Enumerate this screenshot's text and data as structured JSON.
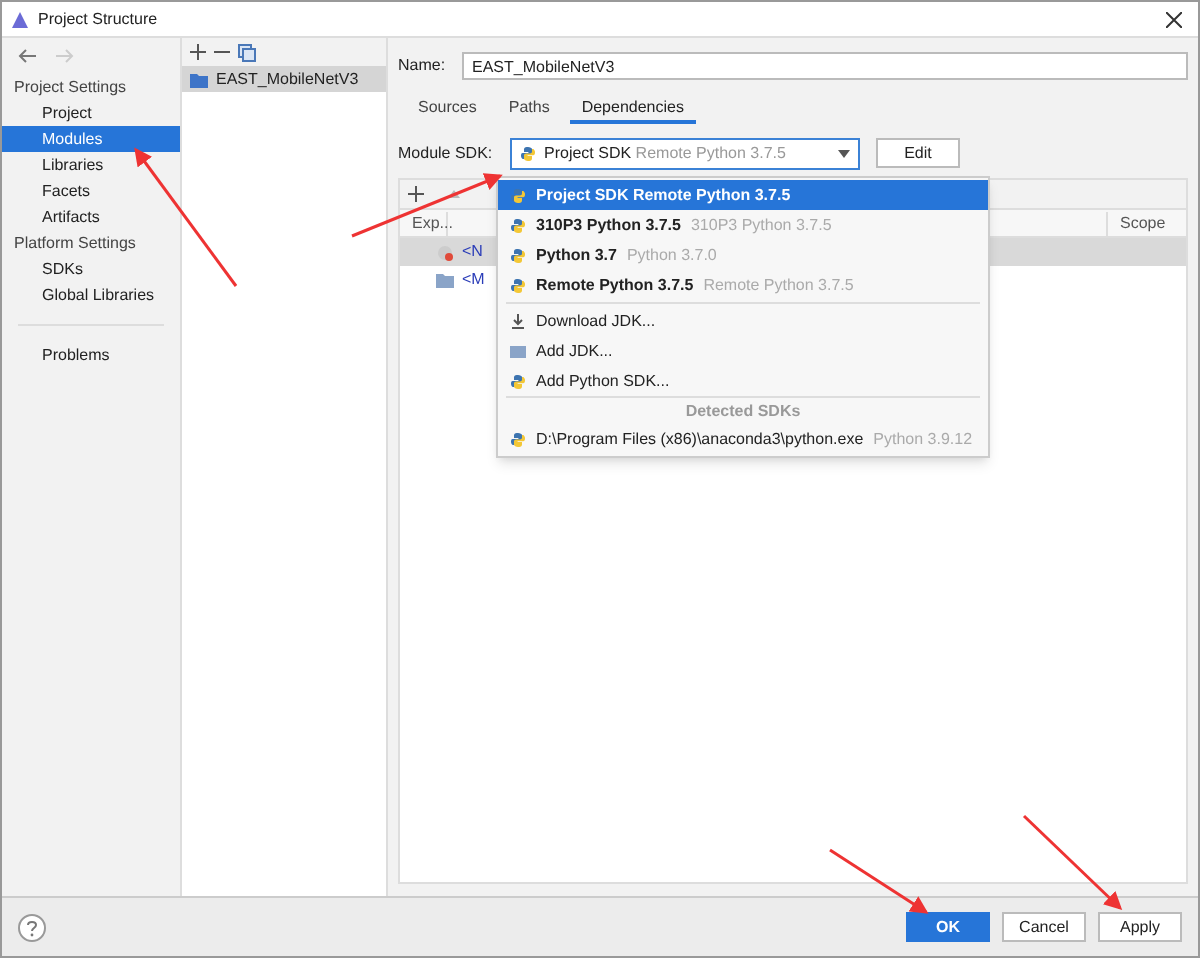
{
  "window": {
    "title": "Project Structure"
  },
  "sidebar": {
    "sections": [
      {
        "title": "Project Settings",
        "items": [
          {
            "label": "Project",
            "selected": false
          },
          {
            "label": "Modules",
            "selected": true
          },
          {
            "label": "Libraries",
            "selected": false
          },
          {
            "label": "Facets",
            "selected": false
          },
          {
            "label": "Artifacts",
            "selected": false
          }
        ]
      },
      {
        "title": "Platform Settings",
        "items": [
          {
            "label": "SDKs",
            "selected": false
          },
          {
            "label": "Global Libraries",
            "selected": false
          }
        ]
      },
      {
        "items": [
          {
            "label": "Problems",
            "selected": false
          }
        ]
      }
    ]
  },
  "modules": [
    {
      "label": "EAST_MobileNetV3",
      "selected": true
    }
  ],
  "name_field": {
    "label": "Name:",
    "value": "EAST_MobileNetV3"
  },
  "tabs": [
    {
      "label": "Sources",
      "selected": false
    },
    {
      "label": "Paths",
      "selected": false
    },
    {
      "label": "Dependencies",
      "selected": true
    }
  ],
  "module_sdk": {
    "label": "Module SDK:",
    "value": "Project SDK",
    "detail": "Remote Python 3.7.5",
    "edit_button": "Edit"
  },
  "table": {
    "columns": [
      "Exp...",
      "Scope"
    ],
    "rows": [
      {
        "kind": "sdk",
        "text": "<N",
        "selected": true
      },
      {
        "kind": "folder",
        "text": "<M",
        "selected": false
      }
    ]
  },
  "dropdown": [
    {
      "kind": "python",
      "text": "Project SDK Remote Python 3.7.5",
      "selected": true
    },
    {
      "kind": "python",
      "text": "310P3 Python 3.7.5",
      "detail": "310P3 Python 3.7.5",
      "selected": false
    },
    {
      "kind": "python",
      "text": "Python 3.7",
      "detail": "Python 3.7.0",
      "selected": false
    },
    {
      "kind": "python",
      "text": "Remote Python 3.7.5",
      "detail": "Remote Python 3.7.5",
      "selected": false
    },
    {
      "kind": "download",
      "text": "Download JDK...",
      "selected": false
    },
    {
      "kind": "jdk",
      "text": "Add JDK...",
      "selected": false
    },
    {
      "kind": "python",
      "text": "Add Python SDK...",
      "selected": false
    },
    {
      "kind": "header",
      "text": "Detected SDKs"
    },
    {
      "kind": "python",
      "text": "D:\\Program Files (x86)\\anaconda3\\python.exe",
      "detail": "Python 3.9.12",
      "selected": false
    }
  ],
  "buttons": [
    {
      "label": "OK",
      "kind": "primary"
    },
    {
      "label": "Cancel",
      "kind": "normal"
    },
    {
      "label": "Apply",
      "kind": "normal"
    }
  ]
}
